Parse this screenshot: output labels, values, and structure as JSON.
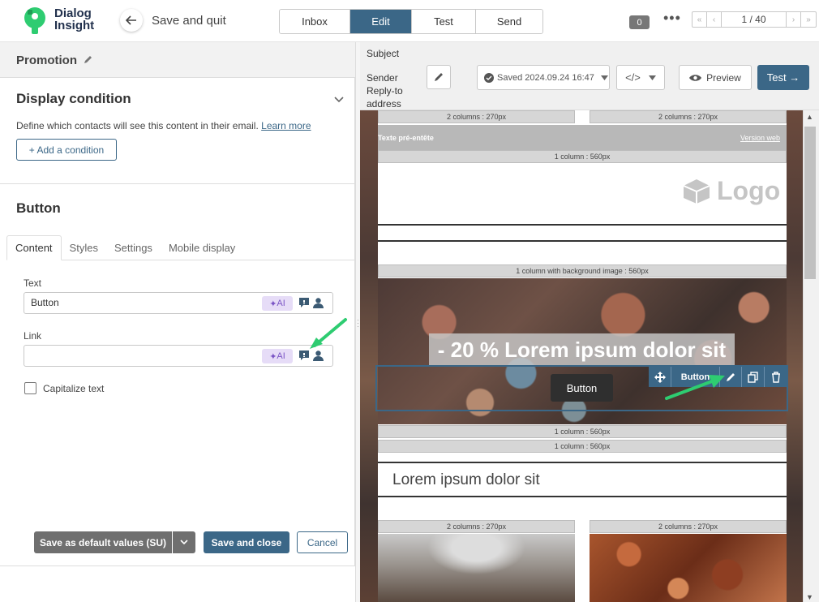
{
  "app": {
    "logo_line1": "Dialog",
    "logo_line2": "Insight",
    "save_quit": "Save and quit"
  },
  "nav_tabs": [
    {
      "label": "Inbox",
      "active": false
    },
    {
      "label": "Edit",
      "active": true
    },
    {
      "label": "Test",
      "active": false
    },
    {
      "label": "Send",
      "active": false
    }
  ],
  "badge_count": "0",
  "pager": {
    "label": "1 / 40",
    "first": "«",
    "prev": "‹",
    "next": "›",
    "last": "»"
  },
  "left": {
    "promo_title": "Promotion",
    "display_condition": {
      "title": "Display condition",
      "desc": "Define which contacts will see this content in their email.",
      "learn_more": "Learn more",
      "add_button": "+ Add a condition"
    },
    "button_section": {
      "title": "Button",
      "tabs": [
        "Content",
        "Styles",
        "Settings",
        "Mobile display"
      ],
      "text_label": "Text",
      "text_value": "Button",
      "link_label": "Link",
      "link_value": "",
      "ai_label": "AI",
      "capitalize_label": "Capitalize text"
    },
    "footer": {
      "save_default": "Save as default values (SU)",
      "save_close": "Save and close",
      "cancel": "Cancel"
    }
  },
  "right": {
    "subject_label": "Subject",
    "sender_label": "Sender Reply-to address",
    "saved_label": "Saved 2024.09.24 16:47",
    "code_label": "</>",
    "preview_label": "Preview",
    "test_label": "Test →"
  },
  "email": {
    "two_col_label": "2 columns : 270px",
    "one_col_label": "1 column : 560px",
    "bg_col_label": "1 column with background image : 560px",
    "preheader_text": "Texte pré-entête",
    "version_web": "Version web",
    "logo_text": "Logo",
    "hero_title": "- 20 % Lorem ipsum dolor sit",
    "hero_button": "Button",
    "toolbar_label": "Button",
    "lorem_title": "Lorem ipsum dolor sit"
  },
  "colors": {
    "brand": "#3b6787",
    "accent_green": "#2ecc71",
    "ai_purple": "#7b55c5"
  }
}
